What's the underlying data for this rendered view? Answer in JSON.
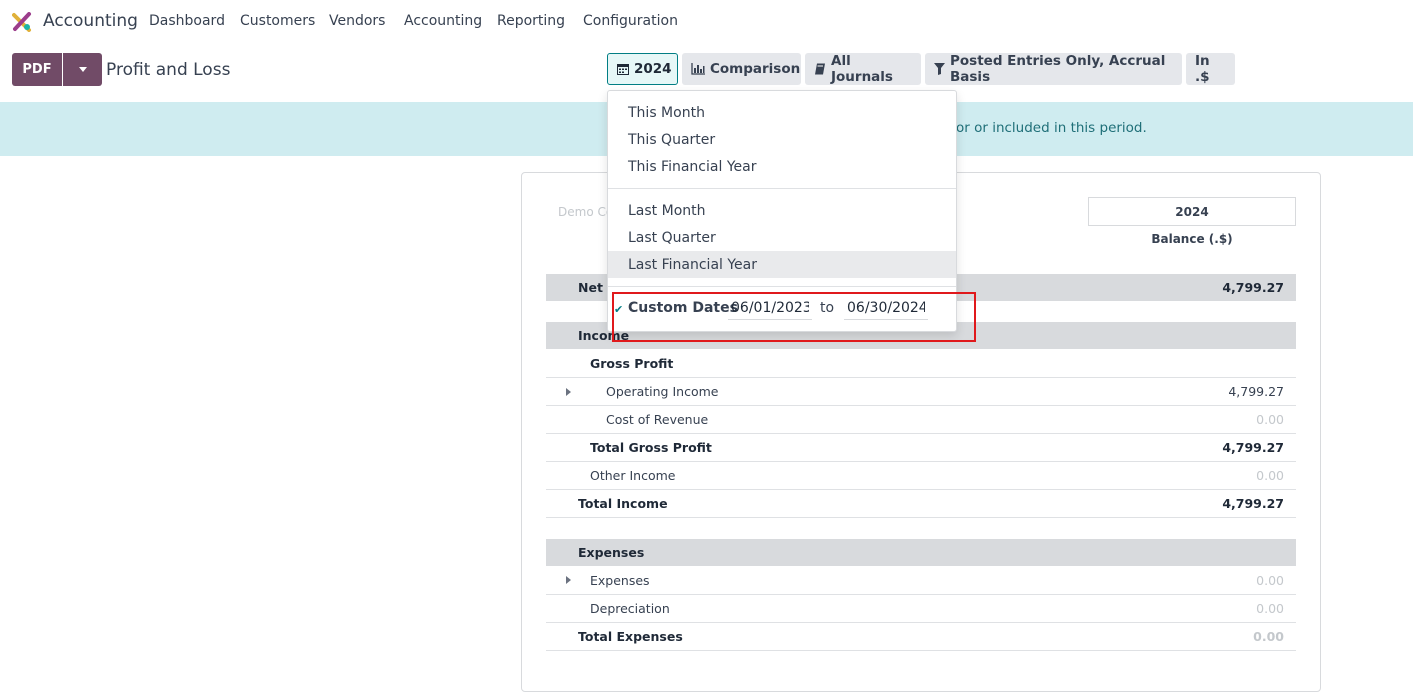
{
  "navbar": {
    "app_name": "Accounting",
    "items": [
      "Dashboard",
      "Customers",
      "Vendors",
      "Accounting",
      "Reporting",
      "Configuration"
    ]
  },
  "control": {
    "pdf_label": "PDF",
    "page_title": "Profit and Loss",
    "filters": {
      "date": "2024",
      "comparison": "Comparison",
      "journals": "All Journals",
      "entries": "Posted Entries Only, Accrual Basis",
      "currency": "In .$"
    }
  },
  "banner": {
    "text": "or or included in this period."
  },
  "date_menu": {
    "group1": [
      "This Month",
      "This Quarter",
      "This Financial Year"
    ],
    "group2": [
      "Last Month",
      "Last Quarter",
      "Last Financial Year"
    ],
    "custom_label": "Custom Dates",
    "date_from": "06/01/2023",
    "to_label": "to",
    "date_to": "06/30/2024"
  },
  "report": {
    "company": "Demo Co",
    "column_header": "2024",
    "column_sub": "Balance (.$)",
    "rows": {
      "net_profit": {
        "label": "Net I",
        "value": "4,799.27"
      },
      "income": {
        "label": "Income"
      },
      "gross_profit": {
        "label": "Gross Profit"
      },
      "operating_income": {
        "label": "Operating Income",
        "value": "4,799.27"
      },
      "cost_of_revenue": {
        "label": "Cost of Revenue",
        "value": "0.00"
      },
      "total_gross_profit": {
        "label": "Total Gross Profit",
        "value": "4,799.27"
      },
      "other_income": {
        "label": "Other Income",
        "value": "0.00"
      },
      "total_income": {
        "label": "Total Income",
        "value": "4,799.27"
      },
      "expenses_header": {
        "label": "Expenses"
      },
      "expenses": {
        "label": "Expenses",
        "value": "0.00"
      },
      "depreciation": {
        "label": "Depreciation",
        "value": "0.00"
      },
      "total_expenses": {
        "label": "Total Expenses",
        "value": "0.00"
      }
    }
  }
}
